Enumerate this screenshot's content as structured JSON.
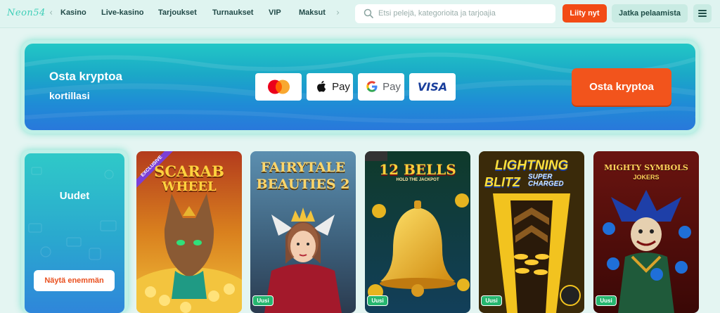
{
  "header": {
    "logo": "Neon54",
    "nav": [
      "Kasino",
      "Live-kasino",
      "Tarjoukset",
      "Turnaukset",
      "VIP",
      "Maksut"
    ],
    "search_placeholder": "Etsi pelejä, kategorioita ja tarjoajia",
    "join_label": "Liity nyt",
    "continue_label": "Jatka pelaamista"
  },
  "banner": {
    "title": "Osta kryptoa",
    "subtitle": "kortillasi",
    "payment_methods": [
      "Mastercard",
      "Apple Pay",
      "Google Pay",
      "VISA"
    ],
    "apple_pay_text": "Pay",
    "google_pay_text": "Pay",
    "visa_text": "VISA",
    "buy_label": "Osta kryptoa"
  },
  "games_section": {
    "title": "Uudet",
    "more_label": "Näytä enemmän",
    "games": [
      {
        "title_line1": "SCARAB",
        "title_line2": "WHEEL",
        "ribbon": "EXCLUSIVE",
        "badge": ""
      },
      {
        "title_line1": "FAIRYTALE",
        "title_line2": "BEAUTIES 2",
        "badge": "Uusi"
      },
      {
        "title_line1": "12 BELLS",
        "title_line2": "HOLD THE JACKPOT",
        "badge": "Uusi"
      },
      {
        "title_line1": "LIGHTNING",
        "title_line2": "BLITZ",
        "title_line3": "SUPER CHARGED",
        "badge": "Uusi"
      },
      {
        "title_line1": "MIGHTY SYMBOLS",
        "title_line2": "JOKERS",
        "badge": "Uusi"
      }
    ]
  },
  "colors": {
    "accent": "#f24b15",
    "banner_top": "#22c7c6",
    "banner_bottom": "#2978db",
    "badge": "#26b66f"
  }
}
